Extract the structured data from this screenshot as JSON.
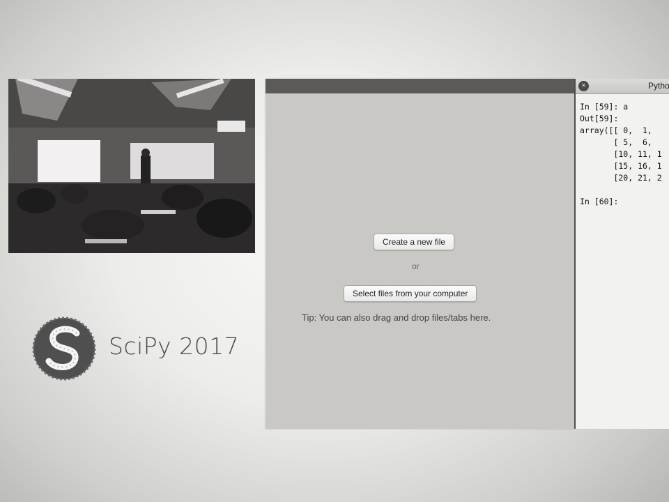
{
  "brand": {
    "name": "SciPy 2017",
    "logo_icon": "scipy-logo-icon"
  },
  "photo": {
    "icon": "conference-room-photo"
  },
  "editor": {
    "create_label": "Create a new file",
    "or_label": "or",
    "select_label": "Select files from your computer",
    "tip": "Tip: You can also drag and drop files/tabs here."
  },
  "console": {
    "title": "Pytho",
    "close_icon": "close-icon",
    "lines": [
      "In [59]: a",
      "Out[59]:",
      "array([[ 0,  1,",
      "       [ 5,  6,",
      "       [10, 11, 1",
      "       [15, 16, 1",
      "       [20, 21, 2",
      "",
      "In [60]:"
    ]
  }
}
